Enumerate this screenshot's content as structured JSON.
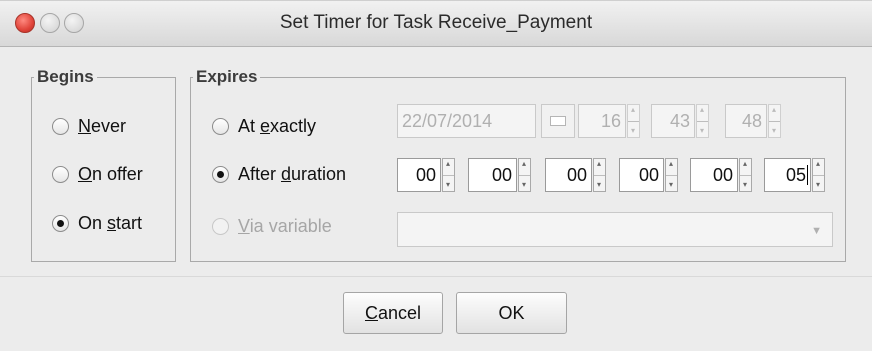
{
  "window": {
    "title": "Set Timer for Task Receive_Payment"
  },
  "begins": {
    "legend": "Begins",
    "options": [
      {
        "mn": "N",
        "rest": "ever",
        "checked": false
      },
      {
        "mn": "O",
        "rest": "n offer",
        "checked": false
      },
      {
        "pre": "On ",
        "mn": "s",
        "rest": "tart",
        "checked": true
      }
    ]
  },
  "expires": {
    "legend": "Expires",
    "at_exactly": {
      "pre": "At ",
      "mn": "e",
      "rest": "xactly",
      "checked": false,
      "date": "22/07/2014",
      "hour": "16",
      "minute": "43",
      "second": "48"
    },
    "after_duration": {
      "pre": "After ",
      "mn": "d",
      "rest": "uration",
      "checked": true,
      "fields": [
        "00",
        "00",
        "00",
        "00",
        "00",
        "05"
      ]
    },
    "via_variable": {
      "mn": "V",
      "rest": "ia variable",
      "checked": false,
      "enabled": false,
      "value": ""
    }
  },
  "buttons": {
    "cancel": {
      "mn": "C",
      "rest": "ancel"
    },
    "ok": {
      "label": "OK"
    }
  }
}
